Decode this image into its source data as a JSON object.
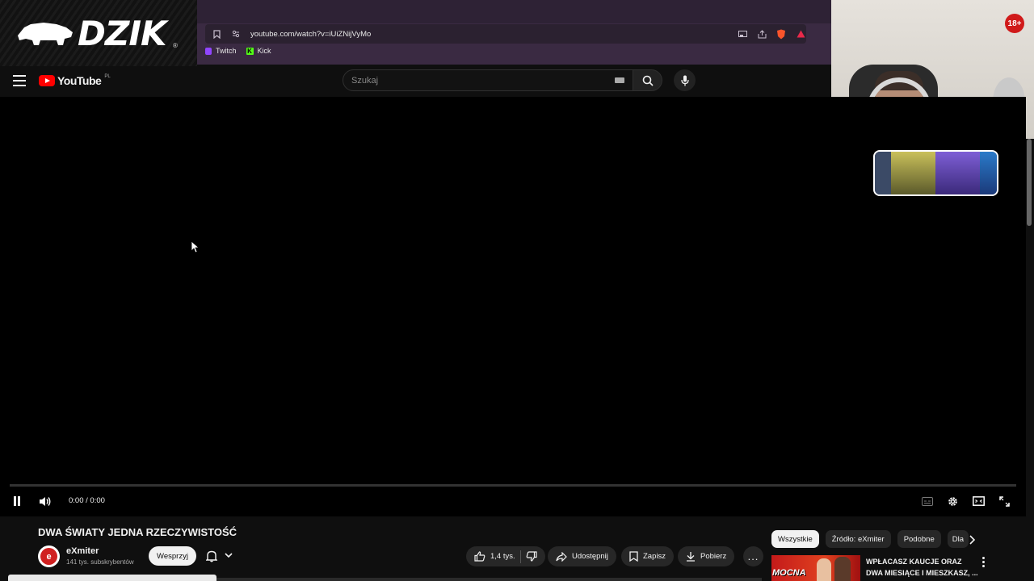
{
  "overlay": {
    "logo_text": "DZIK",
    "logo_mark": "®",
    "age_badge": "18+"
  },
  "browser": {
    "url": "youtube.com/watch?v=iUiZNijVyMo",
    "bookmarks": [
      {
        "label": "Twitch",
        "icon": "twitch-icon"
      },
      {
        "label": "Kick",
        "icon": "kick-icon"
      }
    ]
  },
  "youtube": {
    "logo_text": "YouTube",
    "region": "PL",
    "search_placeholder": "Szukaj"
  },
  "player": {
    "time": "0:00 / 0:00",
    "progress": 0
  },
  "video": {
    "title": "DWA ŚWIATY JEDNA RZECZYWISTOŚĆ",
    "channel": "eXmiter",
    "avatar_letter": "e",
    "subscribers": "141 tys. subskrybentów",
    "support_label": "Wesprzyj",
    "likes": "1,4 tys.",
    "share_label": "Udostępnij",
    "save_label": "Zapisz",
    "download_label": "Pobierz",
    "more_label": "..."
  },
  "chips": [
    "Wszystkie",
    "Źródło: eXmiter",
    "Podobne",
    "Dla"
  ],
  "recommendation": {
    "thumb_text": "MOCNA",
    "title": "WPŁACASZ KAUCJE ORAZ DWA MIESIĄCE I MIESZKASZ, ..."
  },
  "colors": {
    "yt_red": "#ff0000",
    "chrome_bg": "#3a2a42",
    "badge_red": "#d01a1a"
  }
}
